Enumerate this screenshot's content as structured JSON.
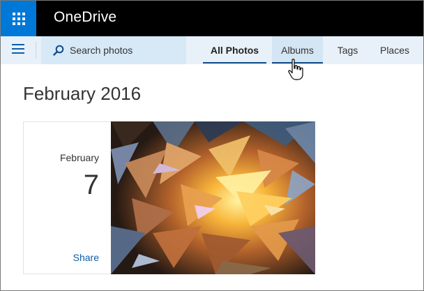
{
  "app": {
    "title": "OneDrive",
    "launcher_icon": "app-launcher-waffle-icon"
  },
  "navbar": {
    "menu_icon": "hamburger-menu-icon",
    "search": {
      "icon": "search-icon",
      "placeholder": "Search photos"
    },
    "tabs": [
      {
        "label": "All Photos",
        "active": true
      },
      {
        "label": "Albums",
        "active": false,
        "hovered": true
      },
      {
        "label": "Tags",
        "active": false
      },
      {
        "label": "Places",
        "active": false
      }
    ]
  },
  "content": {
    "section_title": "February 2016",
    "groups": [
      {
        "month": "February",
        "day": "7",
        "share_label": "Share",
        "photo_icon": "abstract-shards-photo"
      }
    ]
  },
  "colors": {
    "accent": "#0078d7",
    "topbar": "#000000",
    "navbar": "#e8f1f9",
    "search_bg": "#d7e8f6",
    "link": "#0f5ea8",
    "tab_underline": "#0f4c8a"
  }
}
